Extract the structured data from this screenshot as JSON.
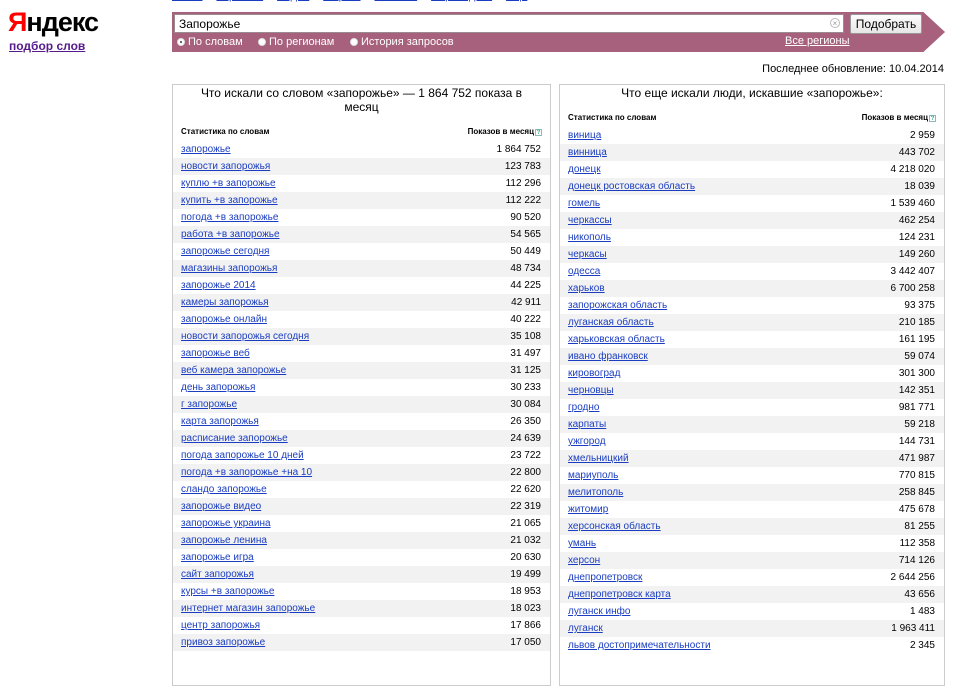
{
  "top_links": [
    "Поиск",
    "Картинки",
    "Видео",
    "Маркет",
    "Новости",
    "Переводчик",
    "ещё"
  ],
  "logo": {
    "first": "Я",
    "rest": "ндекс"
  },
  "subtitle": "подбор слов",
  "search": {
    "value": "Запорожье",
    "submit_label": "Подобрать",
    "modes": [
      "По словам",
      "По регионам",
      "История запросов"
    ],
    "selected_mode": 0,
    "regions_label": "Все регионы"
  },
  "last_update": "Последнее обновление: 10.04.2014",
  "colors": {
    "accent": "#a7617c",
    "link": "#1a3dc1",
    "row_alt": "#f2f2f2"
  },
  "left": {
    "title": "Что искали со словом «запорожье» — 1 864 752 показа в месяц",
    "col1": "Статистика по словам",
    "col2": "Показов в месяц",
    "rows": [
      [
        "запорожье",
        "1 864 752"
      ],
      [
        "новости запорожья",
        "123 783"
      ],
      [
        "куплю +в запорожье",
        "112 296"
      ],
      [
        "купить +в запорожье",
        "112 222"
      ],
      [
        "погода +в запорожье",
        "90 520"
      ],
      [
        "работа +в запорожье",
        "54 565"
      ],
      [
        "запорожье сегодня",
        "50 449"
      ],
      [
        "магазины запорожья",
        "48 734"
      ],
      [
        "запорожье 2014",
        "44 225"
      ],
      [
        "камеры запорожья",
        "42 911"
      ],
      [
        "запорожье онлайн",
        "40 222"
      ],
      [
        "новости запорожья сегодня",
        "35 108"
      ],
      [
        "запорожье веб",
        "31 497"
      ],
      [
        "веб камера запорожье",
        "31 125"
      ],
      [
        "день запорожья",
        "30 233"
      ],
      [
        "г запорожье",
        "30 084"
      ],
      [
        "карта запорожья",
        "26 350"
      ],
      [
        "расписание запорожье",
        "24 639"
      ],
      [
        "погода запорожье 10 дней",
        "23 722"
      ],
      [
        "погода +в запорожье +на 10",
        "22 800"
      ],
      [
        "сландо запорожье",
        "22 620"
      ],
      [
        "запорожье видео",
        "22 319"
      ],
      [
        "запорожье украина",
        "21 065"
      ],
      [
        "запорожье ленина",
        "21 032"
      ],
      [
        "запорожье игра",
        "20 630"
      ],
      [
        "сайт запорожья",
        "19 499"
      ],
      [
        "курсы +в запорожье",
        "18 953"
      ],
      [
        "интернет магазин запорожье",
        "18 023"
      ],
      [
        "центр запорожья",
        "17 866"
      ],
      [
        "привоз запорожье",
        "17 050"
      ]
    ]
  },
  "right": {
    "title": "Что еще искали люди, искавшие «запорожье»:",
    "col1": "Статистика по словам",
    "col2": "Показов в месяц",
    "rows": [
      [
        "виница",
        "2 959"
      ],
      [
        "винница",
        "443 702"
      ],
      [
        "донецк",
        "4 218 020"
      ],
      [
        "донецк ростовская область",
        "18 039"
      ],
      [
        "гомель",
        "1 539 460"
      ],
      [
        "черкассы",
        "462 254"
      ],
      [
        "никополь",
        "124 231"
      ],
      [
        "черкасы",
        "149 260"
      ],
      [
        "одесса",
        "3 442 407"
      ],
      [
        "харьков",
        "6 700 258"
      ],
      [
        "запорожская область",
        "93 375"
      ],
      [
        "луганская область",
        "210 185"
      ],
      [
        "харьковская область",
        "161 195"
      ],
      [
        "ивано франковск",
        "59 074"
      ],
      [
        "кировоград",
        "301 300"
      ],
      [
        "черновцы",
        "142 351"
      ],
      [
        "гродно",
        "981 771"
      ],
      [
        "карпаты",
        "59 218"
      ],
      [
        "ужгород",
        "144 731"
      ],
      [
        "хмельницкий",
        "471 987"
      ],
      [
        "мариуполь",
        "770 815"
      ],
      [
        "мелитополь",
        "258 845"
      ],
      [
        "житомир",
        "475 678"
      ],
      [
        "херсонская область",
        "81 255"
      ],
      [
        "умань",
        "112 358"
      ],
      [
        "херсон",
        "714 126"
      ],
      [
        "днепропетровск",
        "2 644 256"
      ],
      [
        "днепропетровск карта",
        "43 656"
      ],
      [
        "луганск инфо",
        "1 483"
      ],
      [
        "луганск",
        "1 963 411"
      ],
      [
        "львов достопримечательности",
        "2 345"
      ]
    ]
  }
}
